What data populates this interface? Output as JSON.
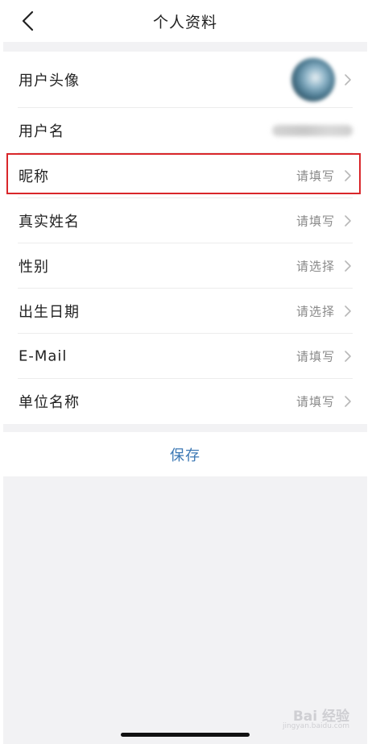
{
  "header": {
    "title": "个人资料"
  },
  "rows": [
    {
      "label": "用户头像"
    },
    {
      "label": "用户名"
    },
    {
      "label": "昵称",
      "value": "请填写"
    },
    {
      "label": "真实姓名",
      "value": "请填写"
    },
    {
      "label": "性别",
      "value": "请选择"
    },
    {
      "label": "出生日期",
      "value": "请选择"
    },
    {
      "label": "E-Mail",
      "value": "请填写"
    },
    {
      "label": "单位名称",
      "value": "请填写"
    }
  ],
  "save": {
    "label": "保存"
  },
  "watermark": {
    "text": "Bai 经验",
    "sub": "jingyan.baidu.com"
  },
  "colors": {
    "accent": "#3c78b4",
    "highlight_border": "#d9262a",
    "background": "#f2f2f4"
  }
}
